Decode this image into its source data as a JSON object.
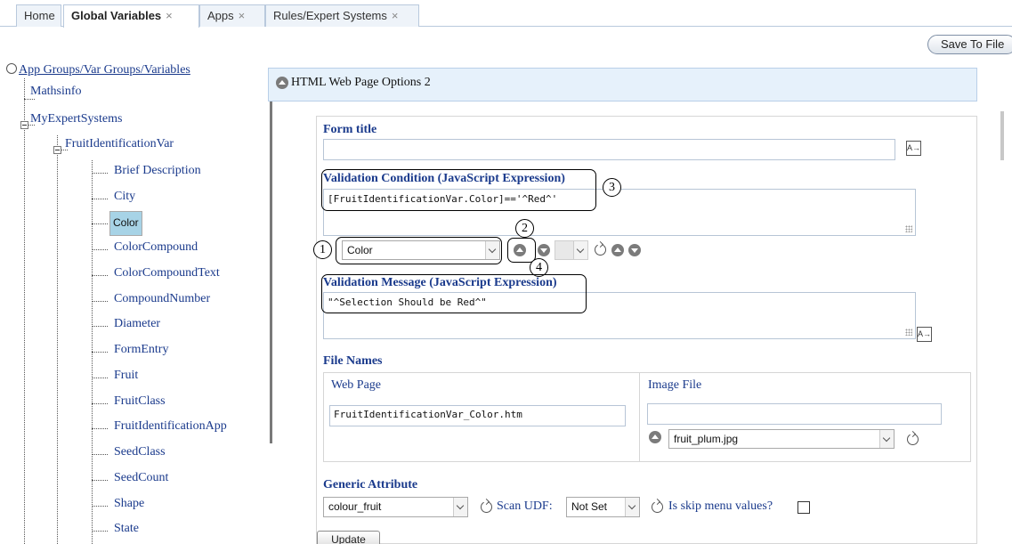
{
  "tabs": [
    {
      "label": "Home",
      "closable": false,
      "active": false
    },
    {
      "label": "Global Variables",
      "closable": true,
      "active": true
    },
    {
      "label": "Apps",
      "closable": true,
      "active": false
    },
    {
      "label": "Rules/Expert Systems",
      "closable": true,
      "active": false
    }
  ],
  "tab_close_glyph": "×",
  "toolbar": {
    "save_label": "Save To File"
  },
  "tree": {
    "root_label": "App Groups/Var Groups/Variables",
    "items": [
      {
        "label": "Mathsinfo"
      },
      {
        "label": "MyExpertSystems"
      },
      {
        "label": "FruitIdentificationVar"
      },
      {
        "label": "Brief Description"
      },
      {
        "label": "City"
      },
      {
        "label": "Color",
        "selected": true
      },
      {
        "label": "ColorCompound"
      },
      {
        "label": "ColorCompoundText"
      },
      {
        "label": "CompoundNumber"
      },
      {
        "label": "Diameter"
      },
      {
        "label": "FormEntry"
      },
      {
        "label": "Fruit"
      },
      {
        "label": "FruitClass"
      },
      {
        "label": "FruitIdentificationApp"
      },
      {
        "label": "SeedClass"
      },
      {
        "label": "SeedCount"
      },
      {
        "label": "Shape"
      },
      {
        "label": "State"
      }
    ]
  },
  "panel": {
    "section_title": "HTML Web Page Options 2",
    "form_title_label": "Form title",
    "form_title_value": "",
    "validation_condition_label": "Validation Condition (JavaScript Expression)",
    "validation_condition_value": "[FruitIdentificationVar.Color]=='^Red^'",
    "variable_select_value": "Color",
    "validation_message_label": "Validation Message (JavaScript Expression)",
    "validation_message_value": "\"^Selection Should be Red^\"",
    "file_names_label": "File Names",
    "web_page_label": "Web Page",
    "web_page_value": "FruitIdentificationVar_Color.htm",
    "image_file_label": "Image File",
    "image_file_value": "",
    "image_select_value": "fruit_plum.jpg",
    "generic_attribute_label": "Generic Attribute",
    "generic_attribute_value": "colour_fruit",
    "scan_udf_label": "Scan UDF:",
    "scan_udf_value": "Not Set",
    "skip_menu_label": "Is skip menu values?",
    "skip_menu_checked": false,
    "update_label": "Update"
  },
  "callouts": [
    "1",
    "2",
    "3",
    "4"
  ],
  "icons": {
    "collapse": "chevron-up-circle-icon",
    "expand": "chevron-down-circle-icon",
    "refresh": "refresh-icon",
    "translate": "translate-icon"
  },
  "colors": {
    "link_text": "#1a3a8c",
    "selected_row": "#a7d3e6",
    "section_header_bg": "#e6f1fb",
    "icon_gray": "#7b7b7b"
  }
}
